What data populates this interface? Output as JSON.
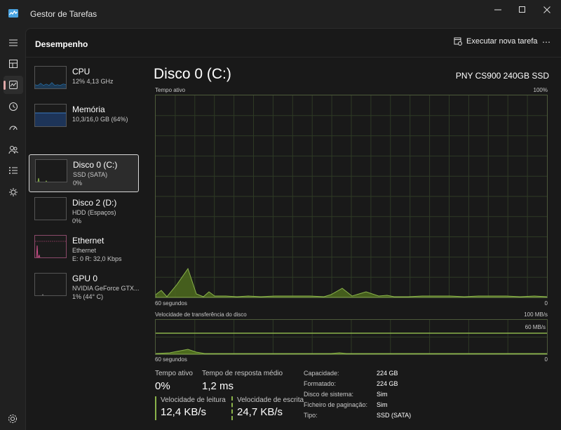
{
  "window": {
    "title": "Gestor de Tarefas",
    "icon": "task-manager-icon"
  },
  "nav": {
    "items": [
      {
        "name": "menu-icon"
      },
      {
        "name": "processes-icon"
      },
      {
        "name": "performance-icon",
        "active": true
      },
      {
        "name": "app-history-icon"
      },
      {
        "name": "startup-icon"
      },
      {
        "name": "users-icon"
      },
      {
        "name": "details-icon"
      },
      {
        "name": "services-icon"
      }
    ],
    "settings": "settings-icon"
  },
  "header": {
    "title": "Desempenho",
    "run_task_label": "Executar nova tarefa",
    "more_label": "⋯"
  },
  "devices": [
    {
      "name": "CPU",
      "sub1": "12%  4,13 GHz",
      "sub2": "",
      "color": "#2d8bd0"
    },
    {
      "name": "Memória",
      "sub1": "10,3/16,0 GB (64%)",
      "sub2": "",
      "color": "#3a7ac0"
    },
    {
      "name": "Disco 0 (C:)",
      "sub1": "SSD (SATA)",
      "sub2": "0%",
      "color": "#8ab34a",
      "selected": true
    },
    {
      "name": "Disco 2 (D:)",
      "sub1": "HDD (Espaços)",
      "sub2": "0%",
      "color": "#8ab34a"
    },
    {
      "name": "Ethernet",
      "sub1": "Ethernet",
      "sub2": "E: 0 R: 32,0 Kbps",
      "color": "#d0508a"
    },
    {
      "name": "GPU 0",
      "sub1": "NVIDIA GeForce GTX...",
      "sub2": "1%  (44° C)",
      "color": "#888888"
    }
  ],
  "detail": {
    "title": "Disco 0 (C:)",
    "model": "PNY CS900 240GB SSD",
    "graph1": {
      "label": "Tempo ativo",
      "max_label": "100%",
      "time_label": "60 segundos",
      "min_label": "0"
    },
    "graph2": {
      "label": "Velocidade de transferência do disco",
      "max_label": "100 MB/s",
      "mid_label": "60 MB/s",
      "time_label": "60 segundos",
      "min_label": "0"
    },
    "stats": {
      "active_label": "Tempo ativo",
      "active_value": "0%",
      "response_label": "Tempo de resposta médio",
      "response_value": "1,2 ms",
      "read_label": "Velocidade de leitura",
      "read_value": "12,4 KB/s",
      "write_label": "Velocidade de escrita",
      "write_value": "24,7 KB/s"
    },
    "properties": [
      {
        "key": "Capacidade:",
        "value": "224 GB"
      },
      {
        "key": "Formatado:",
        "value": "224 GB"
      },
      {
        "key": "Disco de sistema:",
        "value": "Sim"
      },
      {
        "key": "Ficheiro de paginação:",
        "value": "Sim"
      },
      {
        "key": "Tipo:",
        "value": "SSD (SATA)"
      }
    ]
  },
  "colors": {
    "accent_disk": "#8ab34a",
    "nav_active": "#e0a8a8"
  }
}
